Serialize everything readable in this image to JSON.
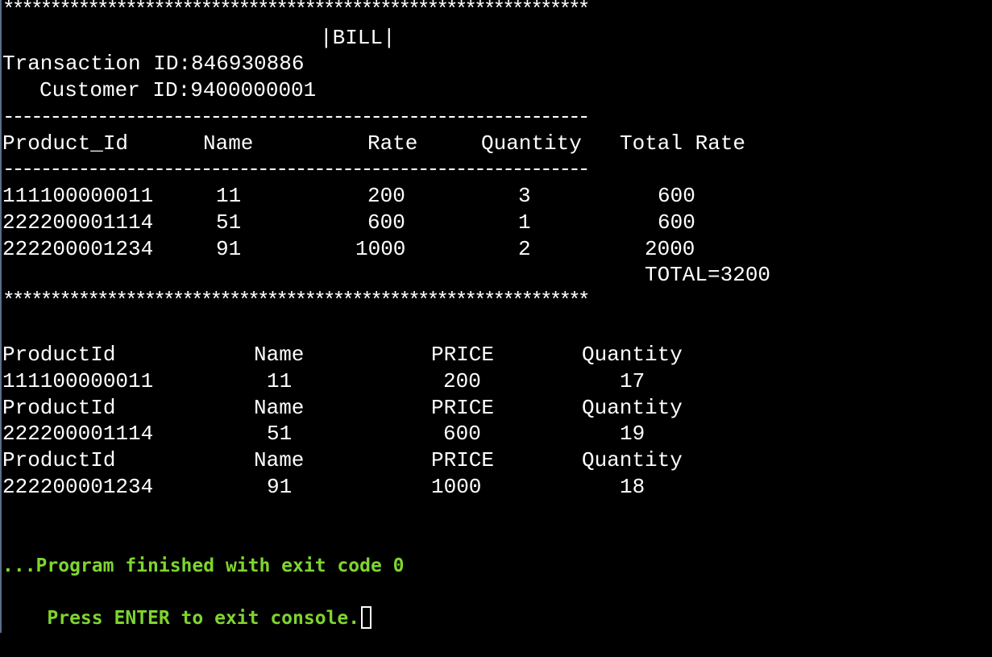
{
  "bill": {
    "stars_top": "**************************************************************",
    "title": "|BILL|",
    "transaction_id": "Transaction ID:846930886",
    "customer_id": "Customer ID:9400000001",
    "dash_line": "--------------------------------------------------------------",
    "headers": [
      "Product_Id",
      "Name",
      "Rate",
      "Quantity",
      "Total Rate"
    ],
    "rows": [
      {
        "product_id": "111100000011",
        "name": "11",
        "rate": "200",
        "quantity": "3",
        "total_rate": "600"
      },
      {
        "product_id": "222200001114",
        "name": "51",
        "rate": "600",
        "quantity": "1",
        "total_rate": "600"
      },
      {
        "product_id": "222200001234",
        "name": "91",
        "rate": "1000",
        "quantity": "2",
        "total_rate": "2000"
      }
    ],
    "total": "TOTAL=3200",
    "stars_bottom": "**************************************************************"
  },
  "inventory": [
    {
      "headers": [
        "ProductId",
        "Name",
        "PRICE",
        "Quantity"
      ],
      "product_id": "111100000011",
      "name": "11",
      "price": "200",
      "quantity": "17"
    },
    {
      "headers": [
        "ProductId",
        "Name",
        "PRICE",
        "Quantity"
      ],
      "product_id": "222200001114",
      "name": "51",
      "price": "600",
      "quantity": "19"
    },
    {
      "headers": [
        "ProductId",
        "Name",
        "PRICE",
        "Quantity"
      ],
      "product_id": "222200001234",
      "name": "91",
      "price": "1000",
      "quantity": "18"
    }
  ],
  "footer": {
    "finished": "...Program finished with exit code 0",
    "press_enter": "Press ENTER to exit console."
  },
  "colors": {
    "background": "#000000",
    "text": "#ffffff",
    "status_text": "#7ed52f"
  }
}
